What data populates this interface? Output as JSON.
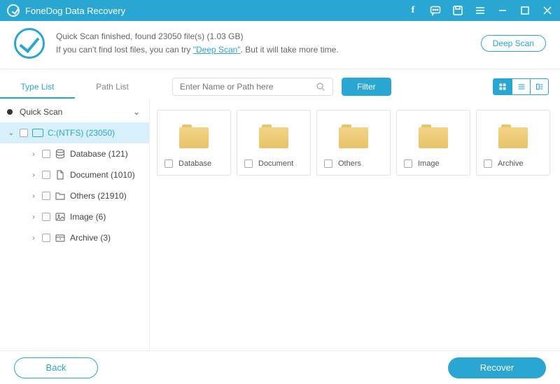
{
  "app": {
    "title": "FoneDog Data Recovery"
  },
  "status": {
    "line1": "Quick Scan finished, found 23050 file(s) (1.03 GB)",
    "line2_pre": "If you can't find lost files, you can try ",
    "deepscan_link": "\"Deep Scan\"",
    "line2_post": ". But it will take more time.",
    "deepscan_button": "Deep Scan"
  },
  "tabs": {
    "type": "Type List",
    "path": "Path List"
  },
  "search": {
    "placeholder": "Enter Name or Path here"
  },
  "filter": "Filter",
  "sidebar": {
    "root": "Quick Scan",
    "drive": "C:(NTFS) (23050)",
    "items": [
      {
        "label": "Database (121)"
      },
      {
        "label": "Document (1010)"
      },
      {
        "label": "Others (21910)"
      },
      {
        "label": "Image (6)"
      },
      {
        "label": "Archive (3)"
      }
    ]
  },
  "folders": [
    {
      "name": "Database"
    },
    {
      "name": "Document"
    },
    {
      "name": "Others"
    },
    {
      "name": "Image"
    },
    {
      "name": "Archive"
    }
  ],
  "footer": {
    "back": "Back",
    "recover": "Recover"
  }
}
